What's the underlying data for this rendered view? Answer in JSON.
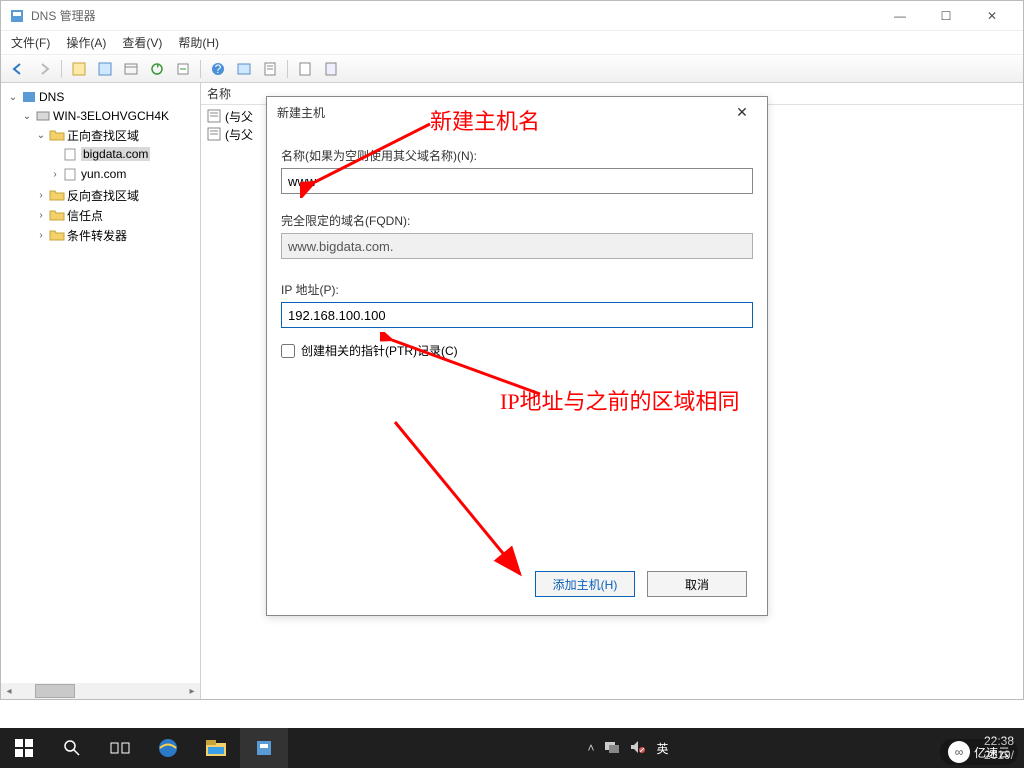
{
  "window": {
    "title": "DNS 管理器",
    "buttons": {
      "min": "—",
      "max": "☐",
      "close": "✕"
    }
  },
  "menu": {
    "file": "文件(F)",
    "action": "操作(A)",
    "view": "查看(V)",
    "help": "帮助(H)"
  },
  "tree": {
    "root": "DNS",
    "server": "WIN-3ELOHVGCH4K",
    "zones": {
      "forward": "正向查找区域",
      "bigdata": "bigdata.com",
      "yun": "yun.com",
      "reverse": "反向查找区域",
      "trust": "信任点",
      "fwd": "条件转发器"
    }
  },
  "list": {
    "header": "名称",
    "row1": "(与父",
    "row2": "(与父"
  },
  "dialog": {
    "title": "新建主机",
    "name_label": "名称(如果为空则使用其父域名称)(N):",
    "name_value": "www",
    "fqdn_label": "完全限定的域名(FQDN):",
    "fqdn_value": "www.bigdata.com.",
    "ip_label": "IP 地址(P):",
    "ip_value": "192.168.100.100",
    "ptr_label": "创建相关的指针(PTR)记录(C)",
    "ok": "添加主机(H)",
    "cancel": "取消"
  },
  "annotations": {
    "a1": "新建主机名",
    "a2": "IP地址与之前的区域相同"
  },
  "taskbar": {
    "ime": "英",
    "time": "22:38",
    "date": "2019/"
  },
  "watermark": "亿速云"
}
